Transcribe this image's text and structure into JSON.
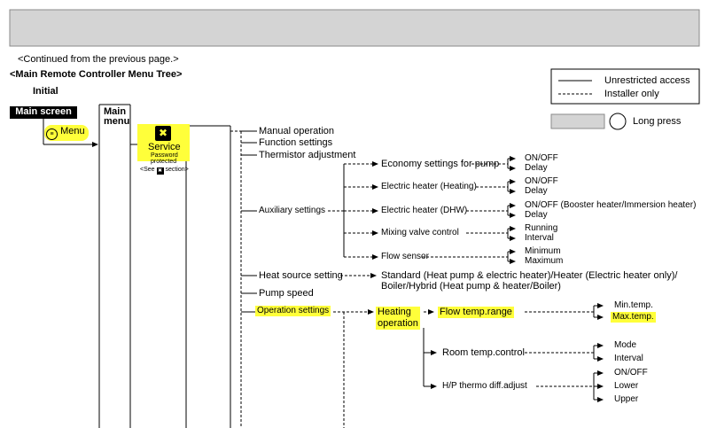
{
  "header_note": "<Continued from the previous page.>",
  "title": "<Main Remote Controller Menu Tree>",
  "legend": {
    "unrestricted": "Unrestricted access",
    "installer": "Installer only",
    "long_press": "Long   press"
  },
  "initial": "Initial",
  "main_screen": "Main screen",
  "menu_button": "Menu",
  "main_menu": [
    "Main",
    "menu"
  ],
  "service": {
    "label": "Service",
    "sub1": "Password",
    "sub2": "protected",
    "see_prefix": "<See",
    "see_suffix": "section>"
  },
  "level1": {
    "manual_operation": "Manual operation",
    "function_settings": "Function settings",
    "thermistor_adjustment": "Thermistor adjustment",
    "auxiliary_settings": "Auxiliary settings",
    "heat_source_setting": "Heat source setting",
    "pump_speed": "Pump speed",
    "operation_settings": "Operation settings"
  },
  "aux": {
    "economy_pump": "Economy settings for pump",
    "heater_heating": "Electric heater (Heating)",
    "heater_dhw": "Electric heater (DHW)",
    "mixing_valve": "Mixing valve control",
    "flow_sensor": "Flow sensor"
  },
  "aux_options": {
    "economy": [
      "ON/OFF",
      "Delay"
    ],
    "heating": [
      "ON/OFF",
      "Delay"
    ],
    "dhw": [
      "ON/OFF (Booster heater/Immersion heater)",
      "Delay"
    ],
    "mixing": [
      "Running",
      "Interval"
    ],
    "flow": [
      "Minimum",
      "Maximum"
    ]
  },
  "heat_source_options": [
    "Standard (Heat pump & electric heater)/Heater (Electric heater only)/",
    "Boiler/Hybrid (Heat pump & heater/Boiler)"
  ],
  "operation": {
    "heating_operation": [
      "Heating",
      "operation"
    ],
    "flow_temp_range": "Flow temp.range",
    "room_temp_control": "Room temp.control",
    "hp_thermo": "H/P thermo diff.adjust",
    "flow_range_options": [
      "Min.temp.",
      "Max.temp."
    ],
    "room_options": [
      "Mode",
      "Interval"
    ],
    "thermo_options": [
      "ON/OFF",
      "Lower",
      "Upper"
    ]
  },
  "colors": {
    "highlight": "#ffff3a",
    "header_bar": "#d4d4d4",
    "main_screen_bg": "#000000"
  }
}
